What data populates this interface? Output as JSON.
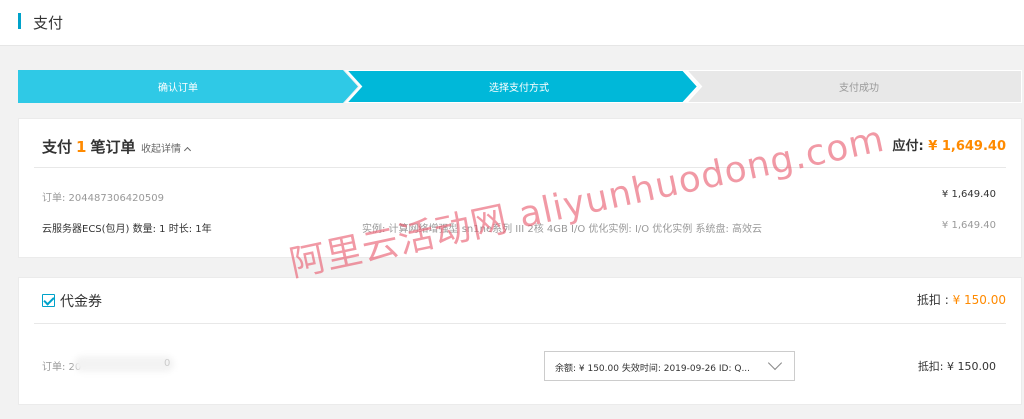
{
  "header": {
    "title": "支付"
  },
  "steps": [
    {
      "label": "确认订单"
    },
    {
      "label": "选择支付方式"
    },
    {
      "label": "支付成功"
    }
  ],
  "order_summary": {
    "title_prefix": "支付",
    "count": "1",
    "title_suffix": "笔订单",
    "collapse_label": "收起详情",
    "due_label": "应付:",
    "due_amount": "¥ 1,649.40",
    "order_number": "订单: 204487306420509",
    "order_total": "¥ 1,649.40",
    "product": "云服务器ECS(包月) 数量: 1 时长: 1年",
    "spec": "实例: 计算网络增强型 sn1ne系列 III 2核 4GB I/O 优化实例: I/O 优化实例 系统盘: 高效云...",
    "product_price": "¥ 1,649.40"
  },
  "voucher": {
    "title": "代金券",
    "checked": true,
    "deduct_label": "抵扣 :",
    "deduct_amount": "¥ 150.00",
    "order_prefix": "订单: 20",
    "order_tail": "0",
    "select_value": "余额: ¥ 150.00 失效时间: 2019-09-26 ID: Q...",
    "row_deduct": "抵扣: ¥ 150.00"
  },
  "watermark": "阿里云活动网 aliyunhuodong.com",
  "colors": {
    "accent": "#00a2ca",
    "step_done": "#2fc9e6",
    "price": "#ff8a00",
    "watermark": "#e85a6e"
  }
}
